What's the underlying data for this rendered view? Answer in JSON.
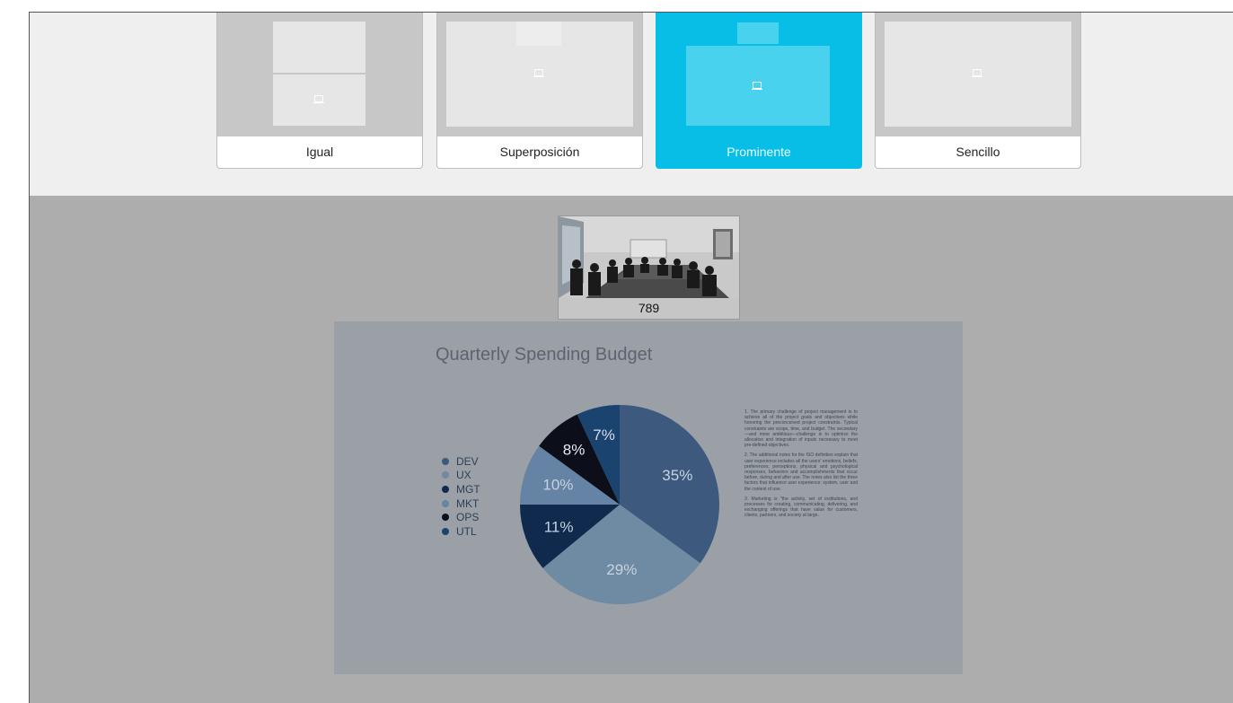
{
  "layouts": [
    {
      "label": "Igual",
      "selected": false
    },
    {
      "label": "Superposición",
      "selected": false
    },
    {
      "label": "Prominente",
      "selected": true
    },
    {
      "label": "Sencillo",
      "selected": false
    }
  ],
  "participant": {
    "name": "789"
  },
  "slide": {
    "title": "Quarterly Spending Budget",
    "notes": [
      "1. The primary challenge of project management is to achieve all of the project goals and objectives while honoring the preconceived project constraints. Typical constraints are scope, time, and budget. The secondary—and more ambitious—challenge is to optimize the allocation and integration of inputs necessary to meet pre-defined objectives.",
      "2. The additional notes for the ISO definition explain that user experience includes all the users' emotions, beliefs, preferences, perceptions, physical and psychological responses, behaviors and accomplishments that occur before, during and after use. The notes also list the three factors that influence user experience: system, user and the context of use.",
      "3. Marketing is \"the activity, set of institutions, and processes for creating, communicating, delivering, and exchanging offerings that have value for customers, clients, partners, and society at large."
    ]
  },
  "chart_data": {
    "type": "pie",
    "title": "Quarterly Spending Budget",
    "legend_position": "left",
    "categories": [
      "DEV",
      "UX",
      "MGT",
      "MKT",
      "OPS",
      "UTL"
    ],
    "values": [
      35,
      29,
      11,
      10,
      8,
      7
    ],
    "labels": [
      "35%",
      "29%",
      "11%",
      "10%",
      "8%",
      "7%"
    ],
    "colors": [
      "#3d5a7e",
      "#6f8aa3",
      "#0f2a4d",
      "#6583a4",
      "#0c0f1a",
      "#1b4370"
    ]
  }
}
